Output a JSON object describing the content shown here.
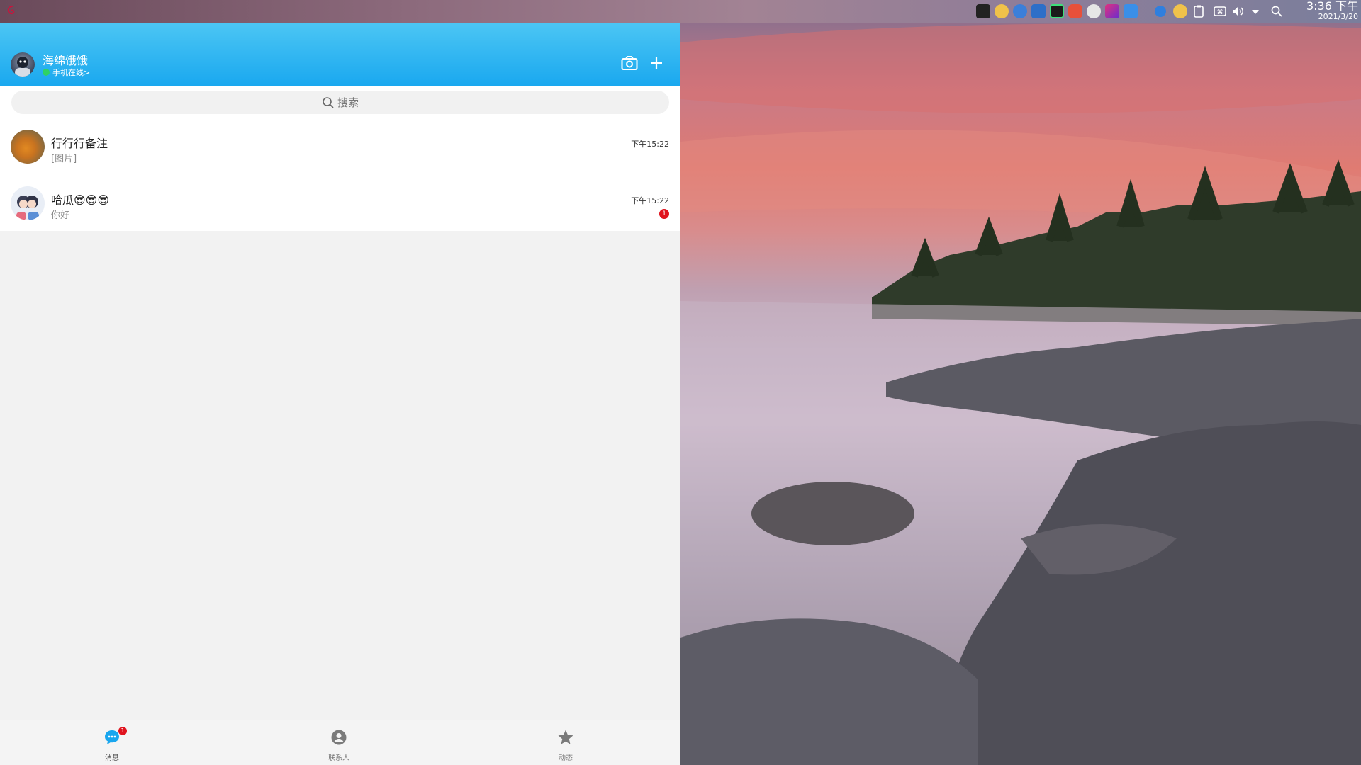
{
  "system_bar": {
    "time": "3:36 下午",
    "date": "2021/3/20",
    "tray_icons": [
      "terminal-icon",
      "ditto-icon",
      "browser-icon",
      "remote-desktop-icon",
      "pycharm-icon",
      "app-icon",
      "disk-icon",
      "intellij-icon",
      "finder-icon",
      "info-icon",
      "ditto-icon",
      "clipboard-icon",
      "keyboard-icon",
      "volume-icon",
      "dropdown-icon",
      "search-icon"
    ]
  },
  "header": {
    "user_name": "海绵饿饿",
    "status": "手机在线>",
    "accent": "#1aa8ef"
  },
  "search": {
    "placeholder": "搜索"
  },
  "conversations": [
    {
      "name": "行行行备注",
      "last_message": "[图片]",
      "time": "下午15:22",
      "unread": ""
    },
    {
      "name": "哈瓜😎😎😎",
      "last_message": "你好",
      "time": "下午15:22",
      "unread": "1"
    }
  ],
  "tabs": [
    {
      "label": "消息",
      "icon": "chat-bubble-icon",
      "badge": "1",
      "active": true
    },
    {
      "label": "联系人",
      "icon": "contact-icon",
      "active": false
    },
    {
      "label": "动态",
      "icon": "star-icon",
      "active": false
    }
  ]
}
